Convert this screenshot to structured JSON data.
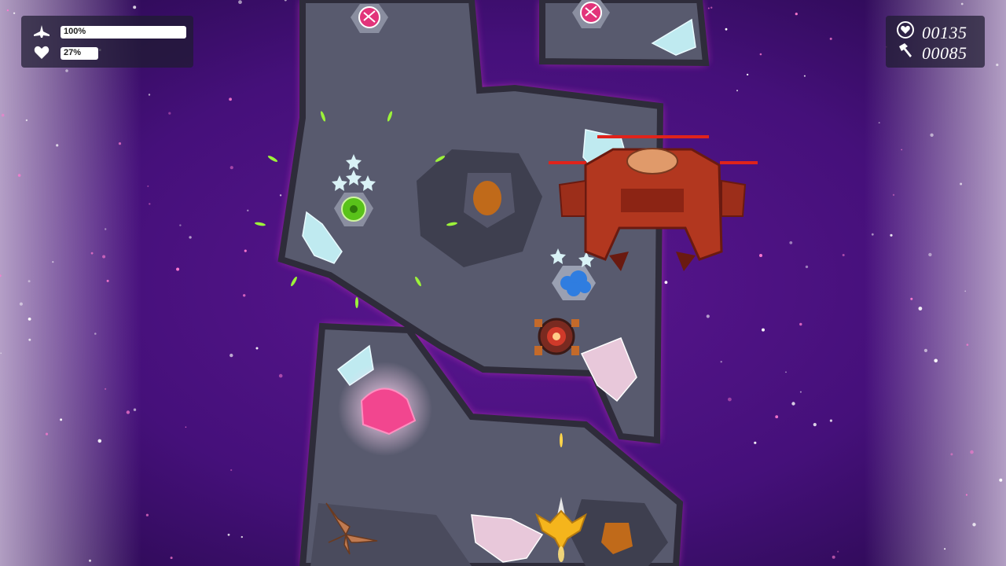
{
  "hud": {
    "ship_health": {
      "icon": "ship-icon",
      "value": 100,
      "label": "100%"
    },
    "shield": {
      "icon": "heart-icon",
      "value": 27,
      "label": "27%"
    },
    "score": {
      "icon": "heart-badge-icon",
      "value": "00135"
    },
    "resources": {
      "icon": "hammer-icon",
      "value": "00085"
    }
  },
  "colors": {
    "space": "#4b0f7a",
    "rock": "#585a6e",
    "rock_edge": "#2e2c3a",
    "glow": "#ff3fd6",
    "enemy": "#b2371f",
    "enemy_bar": "#e0231b",
    "player": "#f5b51c"
  }
}
